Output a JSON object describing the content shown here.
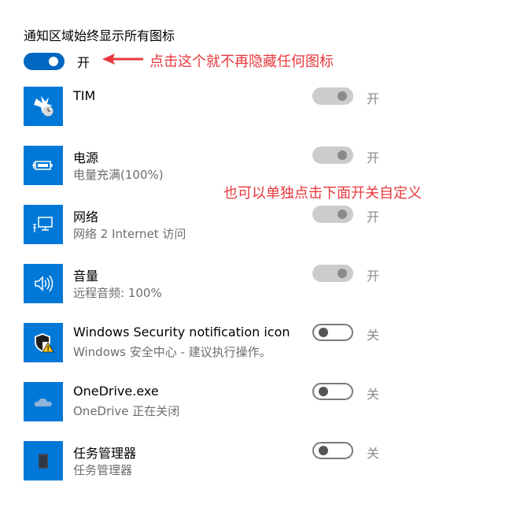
{
  "heading": "通知区域始终显示所有图标",
  "master": {
    "state_label": "开"
  },
  "annotations": {
    "arrow_note": "点击这个就不再隐藏任何图标",
    "custom_note": "也可以单独点击下面开关自定义"
  },
  "colors": {
    "accent": "#0067c0",
    "icon_bg": "#0078d7",
    "annotation": "#e8383d",
    "secondary_text": "#6d6d6d"
  },
  "apps": [
    {
      "name": "TIM",
      "desc": "",
      "state": "开",
      "toggle": "disabled",
      "icon": "tim-icon"
    },
    {
      "name": "电源",
      "desc": "电量充满(100%)",
      "state": "开",
      "toggle": "disabled",
      "icon": "battery-icon"
    },
    {
      "name": "网络",
      "desc": "网络 2 Internet 访问",
      "state": "开",
      "toggle": "disabled",
      "icon": "network-icon"
    },
    {
      "name": "音量",
      "desc": "远程音频: 100%",
      "state": "开",
      "toggle": "disabled",
      "icon": "volume-icon"
    },
    {
      "name": "Windows Security notification icon",
      "desc": "Windows 安全中心 - 建议执行操作。",
      "state": "关",
      "toggle": "off",
      "icon": "shield-warning-icon"
    },
    {
      "name": "OneDrive.exe",
      "desc": "OneDrive 正在关闭",
      "state": "关",
      "toggle": "off",
      "icon": "cloud-icon"
    },
    {
      "name": "任务管理器",
      "desc": "任务管理器",
      "state": "关",
      "toggle": "off",
      "icon": "task-manager-icon"
    }
  ]
}
